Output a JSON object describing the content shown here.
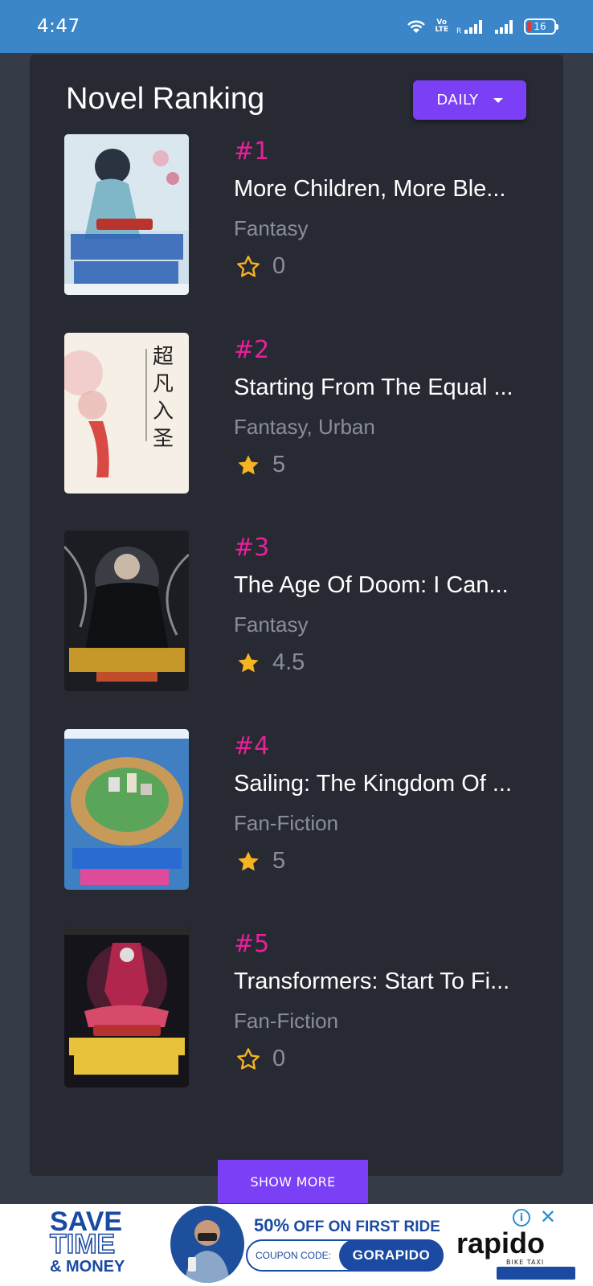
{
  "status_bar": {
    "time": "4:47",
    "network_label": "Vo LTE",
    "battery_level": "16"
  },
  "ranking": {
    "title": "Novel Ranking",
    "period_button": "DAILY",
    "show_more": "SHOW MORE",
    "novels": [
      {
        "rank": "#1",
        "title": "More Children, More Ble...",
        "genre": "Fantasy",
        "rating": "0",
        "star": "empty"
      },
      {
        "rank": "#2",
        "title": "Starting From The Equal ...",
        "genre": "Fantasy, Urban",
        "rating": "5",
        "star": "filled"
      },
      {
        "rank": "#3",
        "title": "The Age Of Doom: I Can...",
        "genre": "Fantasy",
        "rating": "4.5",
        "star": "filled"
      },
      {
        "rank": "#4",
        "title": "Sailing: The Kingdom Of ...",
        "genre": "Fan-Fiction",
        "rating": "5",
        "star": "filled"
      },
      {
        "rank": "#5",
        "title": "Transformers: Start To Fi...",
        "genre": "Fan-Fiction",
        "rating": "0",
        "star": "empty"
      }
    ]
  },
  "ad": {
    "headline_1": "SAVE",
    "headline_2": "TIME",
    "headline_3": "& MONEY",
    "offer_percent": "50%",
    "offer_text": "OFF ON FIRST RIDE",
    "coupon_label": "COUPON CODE:",
    "coupon_code": "GORAPIDO",
    "brand": "rapido",
    "brand_sub": "BIKE TAXI"
  },
  "colors": {
    "accent": "#7b3ff5",
    "rank": "#e8209a",
    "star": "#f7b320",
    "status_bar": "#3a86c8"
  }
}
